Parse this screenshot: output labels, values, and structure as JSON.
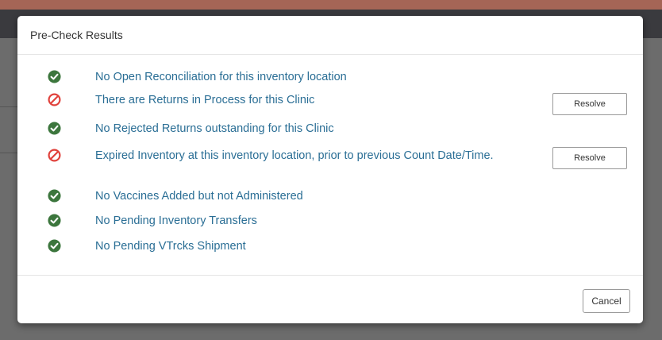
{
  "modal": {
    "title": "Pre-Check Results",
    "checks": [
      {
        "status": "pass",
        "icon": "check-circle-icon",
        "text": "No Open Reconciliation for this inventory location"
      },
      {
        "status": "fail",
        "icon": "prohibited-icon",
        "text": "There are Returns in Process for this Clinic",
        "action_label": "Resolve"
      },
      {
        "status": "pass",
        "icon": "check-circle-icon",
        "text": "No Rejected Returns outstanding for this Clinic"
      },
      {
        "status": "fail",
        "icon": "prohibited-icon",
        "text": "Expired Inventory at this inventory location, prior to previous Count Date/Time.",
        "action_label": "Resolve"
      },
      {
        "status": "pass",
        "icon": "check-circle-icon",
        "text": "No Vaccines Added but not Administered"
      },
      {
        "status": "pass",
        "icon": "check-circle-icon",
        "text": "No Pending Inventory Transfers"
      },
      {
        "status": "pass",
        "icon": "check-circle-icon",
        "text": "No Pending VTrcks Shipment"
      }
    ],
    "cancel_label": "Cancel"
  },
  "colors": {
    "pass": "#3c763d",
    "fail": "#e0413b",
    "link_text": "#2a6e95"
  }
}
